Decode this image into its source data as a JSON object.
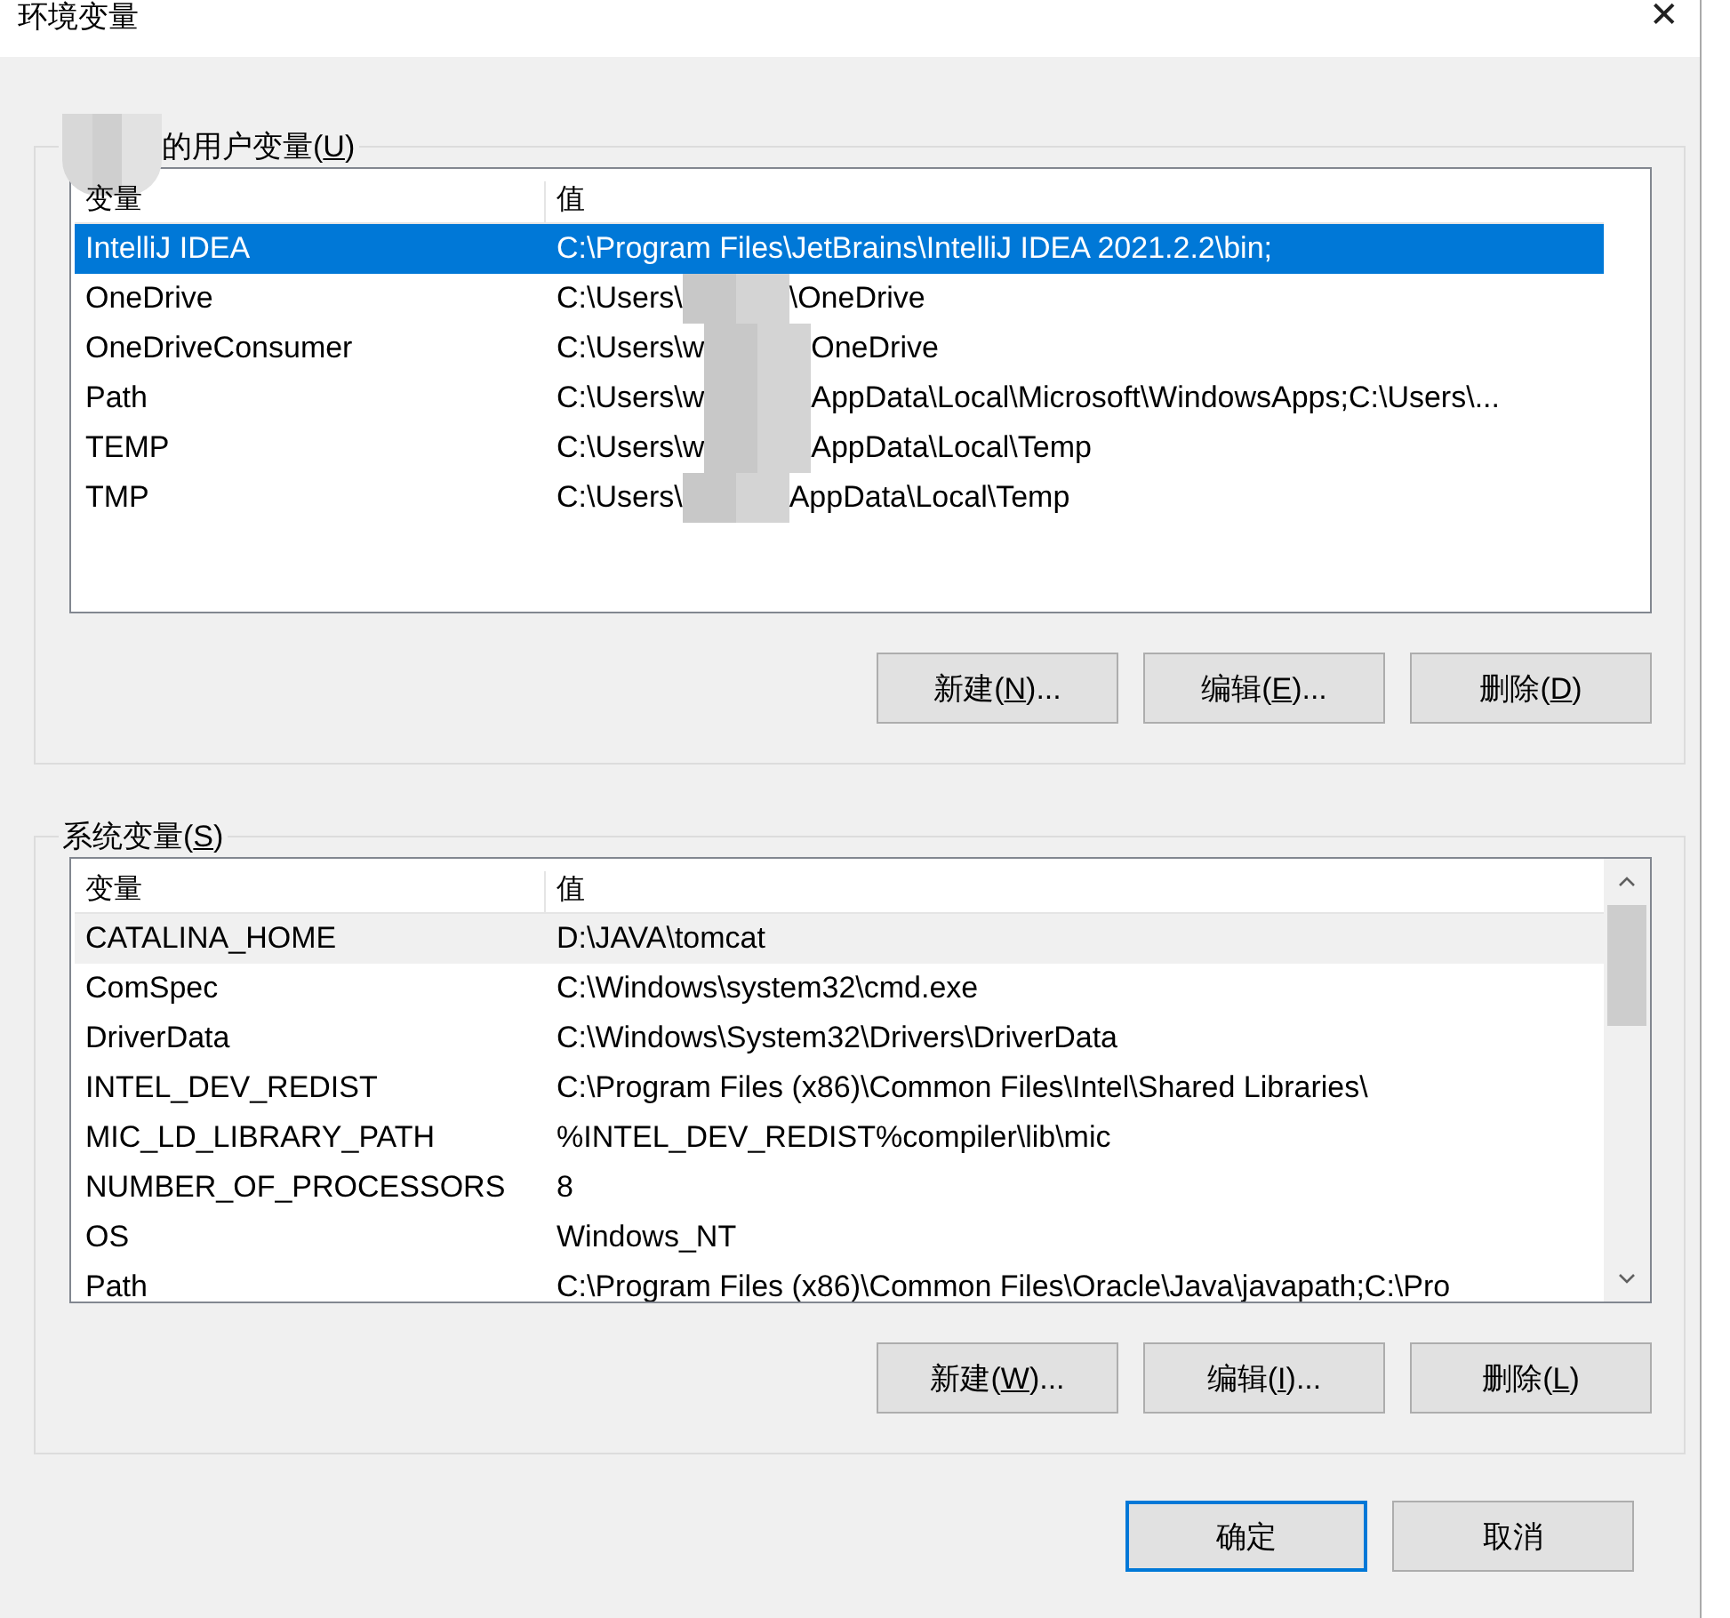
{
  "window": {
    "title": "环境变量",
    "close": "✕"
  },
  "user_group": {
    "title": {
      "before": "的用户变量(",
      "accel": "U",
      "after": ")"
    },
    "table": {
      "columns": [
        "变量",
        "值"
      ],
      "rows": [
        {
          "name": "IntelliJ IDEA",
          "value_parts": [
            "C:\\Program Files\\JetBrains\\IntelliJ IDEA 2021.2.2\\bin;"
          ],
          "selected": true
        },
        {
          "name": "OneDrive",
          "value_parts": [
            "C:\\Users\\",
            "\\OneDrive"
          ],
          "selected": false
        },
        {
          "name": "OneDriveConsumer",
          "value_parts": [
            "C:\\Users\\w",
            "OneDrive"
          ],
          "selected": false
        },
        {
          "name": "Path",
          "value_parts": [
            "C:\\Users\\w",
            "AppData\\Local\\Microsoft\\WindowsApps;C:\\Users\\..."
          ],
          "selected": false
        },
        {
          "name": "TEMP",
          "value_parts": [
            "C:\\Users\\w",
            "AppData\\Local\\Temp"
          ],
          "selected": false
        },
        {
          "name": "TMP",
          "value_parts": [
            "C:\\Users\\",
            "AppData\\Local\\Temp"
          ],
          "selected": false
        }
      ]
    },
    "buttons": [
      {
        "before": "新建(",
        "accel": "N",
        "after": ")..."
      },
      {
        "before": "编辑(",
        "accel": "E",
        "after": ")..."
      },
      {
        "before": "删除(",
        "accel": "D",
        "after": ")"
      }
    ]
  },
  "system_group": {
    "title": {
      "before": "系统变量(",
      "accel": "S",
      "after": ")"
    },
    "table": {
      "columns": [
        "变量",
        "值"
      ],
      "rows": [
        {
          "name": "CATALINA_HOME",
          "value_parts": [
            "D:\\JAVA\\tomcat"
          ],
          "selected": false,
          "hovered": true
        },
        {
          "name": "ComSpec",
          "value_parts": [
            "C:\\Windows\\system32\\cmd.exe"
          ],
          "selected": false,
          "hovered": false
        },
        {
          "name": "DriverData",
          "value_parts": [
            "C:\\Windows\\System32\\Drivers\\DriverData"
          ],
          "selected": false,
          "hovered": false
        },
        {
          "name": "INTEL_DEV_REDIST",
          "value_parts": [
            "C:\\Program Files (x86)\\Common Files\\Intel\\Shared Libraries\\"
          ],
          "selected": false,
          "hovered": false
        },
        {
          "name": "MIC_LD_LIBRARY_PATH",
          "value_parts": [
            "%INTEL_DEV_REDIST%compiler\\lib\\mic"
          ],
          "selected": false,
          "hovered": false
        },
        {
          "name": "NUMBER_OF_PROCESSORS",
          "value_parts": [
            "8"
          ],
          "selected": false,
          "hovered": false
        },
        {
          "name": "OS",
          "value_parts": [
            "Windows_NT"
          ],
          "selected": false,
          "hovered": false
        },
        {
          "name": "Path",
          "value_parts": [
            "C:\\Program Files (x86)\\Common Files\\Oracle\\Java\\javapath;C:\\Pro"
          ],
          "selected": false,
          "hovered": false
        }
      ]
    },
    "buttons": [
      {
        "before": "新建(",
        "accel": "W",
        "after": ")..."
      },
      {
        "before": "编辑(",
        "accel": "I",
        "after": ")..."
      },
      {
        "before": "删除(",
        "accel": "L",
        "after": ")"
      }
    ]
  },
  "footer_buttons": [
    {
      "label": "确定",
      "default": true
    },
    {
      "label": "取消",
      "default": false
    }
  ]
}
